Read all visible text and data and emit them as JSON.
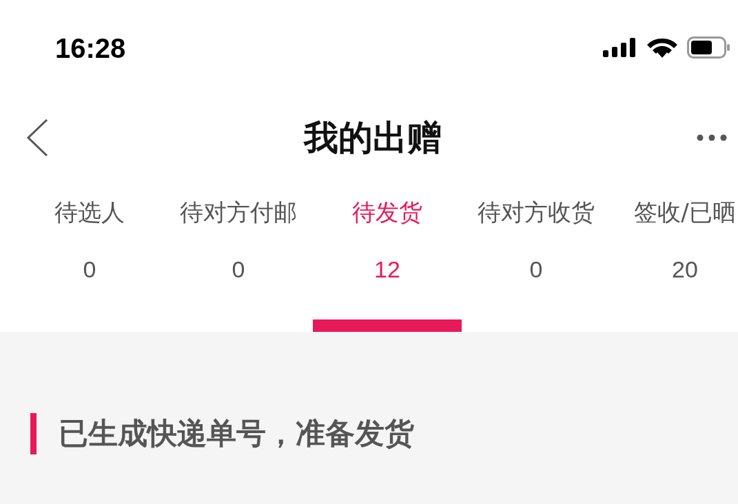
{
  "status_bar": {
    "time": "16:28"
  },
  "nav": {
    "title": "我的出赠"
  },
  "tabs": [
    {
      "label": "待选人",
      "count": "0",
      "selected": false
    },
    {
      "label": "待对方付邮",
      "count": "0",
      "selected": false
    },
    {
      "label": "待发货",
      "count": "12",
      "selected": true
    },
    {
      "label": "待对方收货",
      "count": "0",
      "selected": false
    },
    {
      "label": "签收/已晒",
      "count": "20",
      "selected": false
    }
  ],
  "section": {
    "title": "已生成快递单号，准备发货"
  }
}
